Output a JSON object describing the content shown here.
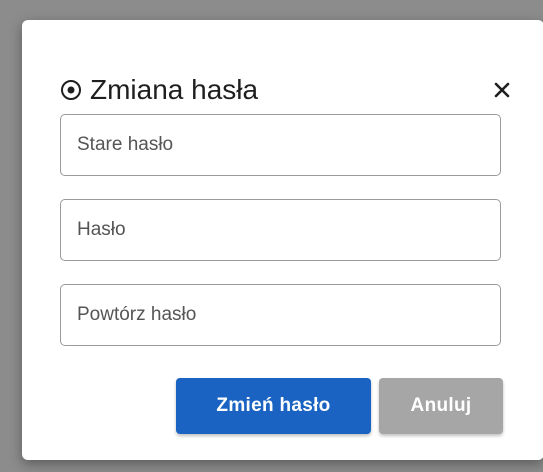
{
  "dialog": {
    "title": "Zmiana hasła",
    "title_icon": "radio-target-icon",
    "close_icon": "close-icon",
    "close_glyph": "✕"
  },
  "form": {
    "old_password": {
      "placeholder": "Stare hasło",
      "value": ""
    },
    "new_password": {
      "placeholder": "Hasło",
      "value": ""
    },
    "repeat_password": {
      "placeholder": "Powtórz hasło",
      "value": ""
    }
  },
  "actions": {
    "submit_label": "Zmień hasło",
    "cancel_label": "Anuluj"
  },
  "colors": {
    "primary": "#1a63c2",
    "secondary": "#a6a6a6",
    "backdrop": "#8c8c8c"
  }
}
